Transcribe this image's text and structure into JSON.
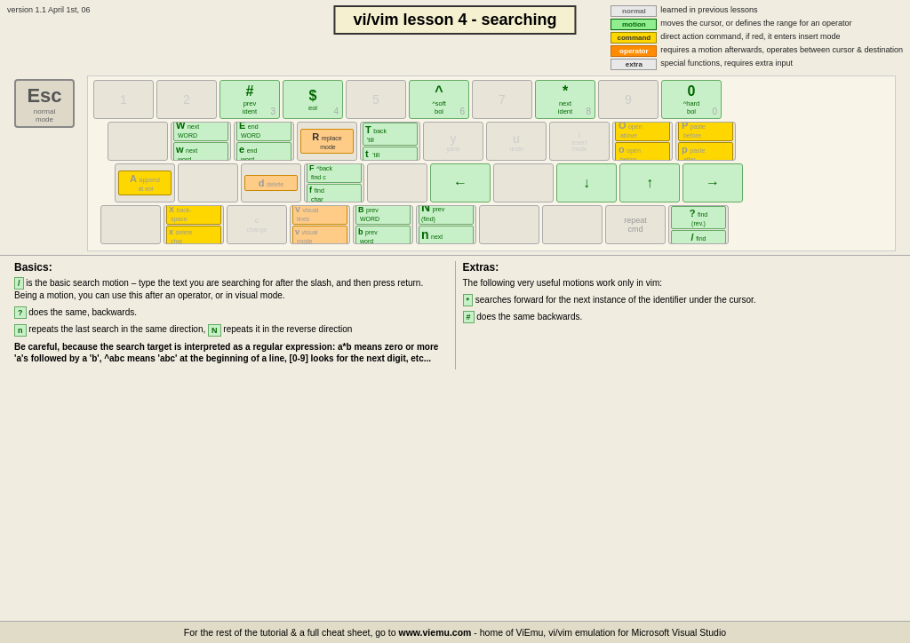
{
  "version": "version 1.1\nApril 1st, 06",
  "title": "vi/vim lesson 4 - searching",
  "legend": {
    "normal": {
      "label": "normal",
      "desc": "learned in previous lessons"
    },
    "motion": {
      "label": "motion",
      "desc": "moves the cursor, or defines the range for an operator"
    },
    "command": {
      "label": "command",
      "desc": "direct action command, if red, it enters insert mode"
    },
    "operator": {
      "label": "operator",
      "desc": "requires a motion afterwards, operates between cursor & destination"
    },
    "extra": {
      "label": "extra",
      "desc": "special functions, requires extra input"
    }
  },
  "esc": {
    "label": "Esc",
    "sub": "normal\nmode"
  },
  "rows": {
    "number": [
      {
        "char": "1",
        "top": "",
        "bot": ""
      },
      {
        "char": "2",
        "top": "",
        "bot": ""
      },
      {
        "char": "3",
        "top": "#",
        "desc1": "prev",
        "desc2": "ident",
        "type": "motion"
      },
      {
        "char": "4",
        "top": "$",
        "desc1": "eol",
        "type": "motion"
      },
      {
        "char": "5",
        "top": "",
        "bot": ""
      },
      {
        "char": "6",
        "top": "^",
        "desc1": "^soft",
        "desc2": "bol",
        "type": "motion"
      },
      {
        "char": "7",
        "top": "",
        "bot": ""
      },
      {
        "char": "8",
        "top": "*",
        "desc1": "next",
        "desc2": "ident",
        "type": "motion"
      },
      {
        "char": "9",
        "top": "",
        "bot": ""
      },
      {
        "char": "0",
        "top": "0",
        "desc1": "^hard",
        "desc2": "bol",
        "type": "motion"
      }
    ]
  },
  "basics": {
    "title": "Basics:",
    "para1": "/ is the basic search motion – type the text you are searching for after the slash, and then press return. Being a motion, you can use this after an operator, or in visual mode.",
    "para2": "? does the same, backwards.",
    "para3": "n repeats the last search in the same direction, N repeats it in the reverse direction",
    "para4": "Be careful, because the search target is interpreted as a regular expression: a*b means zero or more 'a's followed by a 'b', ^abc means 'abc' at the beginning of a line, [0-9] looks for the next digit, etc..."
  },
  "extras": {
    "title": "Extras:",
    "para1": "The following very useful motions work only in vim:",
    "para2": "* searches forward for the next instance of the identifier under the cursor.",
    "para3": "# does the same backwards."
  },
  "footer": "For the rest of the tutorial & a full cheat sheet, go to www.viemu.com - home of ViEmu, vi/vim emulation for Microsoft Visual Studio"
}
